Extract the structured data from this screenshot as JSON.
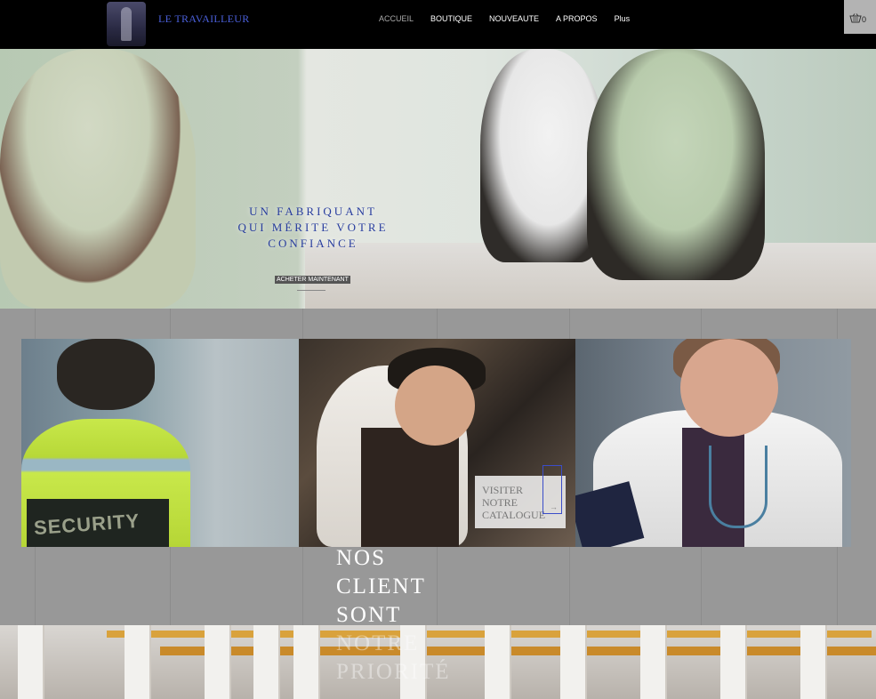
{
  "header": {
    "logo_text": "LE TRAVAILLEUR",
    "nav": [
      {
        "label": "ACCUEIL",
        "active": true
      },
      {
        "label": "BOUTIQUE",
        "active": false
      },
      {
        "label": "NOUVEAUTE",
        "active": false
      },
      {
        "label": "A PROPOS",
        "active": false
      },
      {
        "label": "Plus",
        "active": false
      }
    ],
    "cart_count": "0"
  },
  "hero": {
    "title_lines": [
      "UN FABRIQUANT",
      "QUI MÉRITE VOTRE",
      "CONFIANCE"
    ],
    "button_label": "ACHETER MAINTENANT"
  },
  "tiles": {
    "security_text": "SECURITY",
    "cta_lines": [
      "VISITER",
      "NOTRE",
      "CATALOGUE"
    ],
    "cta_arrow": "→"
  },
  "slogan": {
    "lines": [
      "NOS",
      "CLIENT",
      "SONT",
      "NOTRE",
      "PRIORITÉ"
    ]
  },
  "colors": {
    "header_bg": "#000000",
    "accent_blue": "#283d9e",
    "section_grey": "#989898",
    "cart_bg": "#b3b3b3"
  }
}
